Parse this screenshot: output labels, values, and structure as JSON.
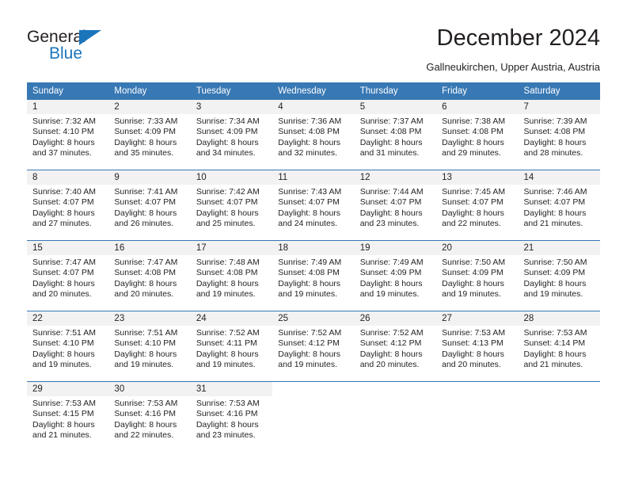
{
  "brand": {
    "name_part1": "General",
    "name_part2": "Blue",
    "color_primary": "#1b75bb",
    "logo_icon": "triangle-icon"
  },
  "header": {
    "title": "December 2024",
    "subtitle": "Gallneukirchen, Upper Austria, Austria"
  },
  "calendar": {
    "header_color": "#3878b4",
    "daynum_background": "#f2f2f2",
    "weekdays": [
      "Sunday",
      "Monday",
      "Tuesday",
      "Wednesday",
      "Thursday",
      "Friday",
      "Saturday"
    ],
    "weeks": [
      [
        {
          "day": "1",
          "sunrise": "Sunrise: 7:32 AM",
          "sunset": "Sunset: 4:10 PM",
          "daylight_line1": "Daylight: 8 hours",
          "daylight_line2": "and 37 minutes."
        },
        {
          "day": "2",
          "sunrise": "Sunrise: 7:33 AM",
          "sunset": "Sunset: 4:09 PM",
          "daylight_line1": "Daylight: 8 hours",
          "daylight_line2": "and 35 minutes."
        },
        {
          "day": "3",
          "sunrise": "Sunrise: 7:34 AM",
          "sunset": "Sunset: 4:09 PM",
          "daylight_line1": "Daylight: 8 hours",
          "daylight_line2": "and 34 minutes."
        },
        {
          "day": "4",
          "sunrise": "Sunrise: 7:36 AM",
          "sunset": "Sunset: 4:08 PM",
          "daylight_line1": "Daylight: 8 hours",
          "daylight_line2": "and 32 minutes."
        },
        {
          "day": "5",
          "sunrise": "Sunrise: 7:37 AM",
          "sunset": "Sunset: 4:08 PM",
          "daylight_line1": "Daylight: 8 hours",
          "daylight_line2": "and 31 minutes."
        },
        {
          "day": "6",
          "sunrise": "Sunrise: 7:38 AM",
          "sunset": "Sunset: 4:08 PM",
          "daylight_line1": "Daylight: 8 hours",
          "daylight_line2": "and 29 minutes."
        },
        {
          "day": "7",
          "sunrise": "Sunrise: 7:39 AM",
          "sunset": "Sunset: 4:08 PM",
          "daylight_line1": "Daylight: 8 hours",
          "daylight_line2": "and 28 minutes."
        }
      ],
      [
        {
          "day": "8",
          "sunrise": "Sunrise: 7:40 AM",
          "sunset": "Sunset: 4:07 PM",
          "daylight_line1": "Daylight: 8 hours",
          "daylight_line2": "and 27 minutes."
        },
        {
          "day": "9",
          "sunrise": "Sunrise: 7:41 AM",
          "sunset": "Sunset: 4:07 PM",
          "daylight_line1": "Daylight: 8 hours",
          "daylight_line2": "and 26 minutes."
        },
        {
          "day": "10",
          "sunrise": "Sunrise: 7:42 AM",
          "sunset": "Sunset: 4:07 PM",
          "daylight_line1": "Daylight: 8 hours",
          "daylight_line2": "and 25 minutes."
        },
        {
          "day": "11",
          "sunrise": "Sunrise: 7:43 AM",
          "sunset": "Sunset: 4:07 PM",
          "daylight_line1": "Daylight: 8 hours",
          "daylight_line2": "and 24 minutes."
        },
        {
          "day": "12",
          "sunrise": "Sunrise: 7:44 AM",
          "sunset": "Sunset: 4:07 PM",
          "daylight_line1": "Daylight: 8 hours",
          "daylight_line2": "and 23 minutes."
        },
        {
          "day": "13",
          "sunrise": "Sunrise: 7:45 AM",
          "sunset": "Sunset: 4:07 PM",
          "daylight_line1": "Daylight: 8 hours",
          "daylight_line2": "and 22 minutes."
        },
        {
          "day": "14",
          "sunrise": "Sunrise: 7:46 AM",
          "sunset": "Sunset: 4:07 PM",
          "daylight_line1": "Daylight: 8 hours",
          "daylight_line2": "and 21 minutes."
        }
      ],
      [
        {
          "day": "15",
          "sunrise": "Sunrise: 7:47 AM",
          "sunset": "Sunset: 4:07 PM",
          "daylight_line1": "Daylight: 8 hours",
          "daylight_line2": "and 20 minutes."
        },
        {
          "day": "16",
          "sunrise": "Sunrise: 7:47 AM",
          "sunset": "Sunset: 4:08 PM",
          "daylight_line1": "Daylight: 8 hours",
          "daylight_line2": "and 20 minutes."
        },
        {
          "day": "17",
          "sunrise": "Sunrise: 7:48 AM",
          "sunset": "Sunset: 4:08 PM",
          "daylight_line1": "Daylight: 8 hours",
          "daylight_line2": "and 19 minutes."
        },
        {
          "day": "18",
          "sunrise": "Sunrise: 7:49 AM",
          "sunset": "Sunset: 4:08 PM",
          "daylight_line1": "Daylight: 8 hours",
          "daylight_line2": "and 19 minutes."
        },
        {
          "day": "19",
          "sunrise": "Sunrise: 7:49 AM",
          "sunset": "Sunset: 4:09 PM",
          "daylight_line1": "Daylight: 8 hours",
          "daylight_line2": "and 19 minutes."
        },
        {
          "day": "20",
          "sunrise": "Sunrise: 7:50 AM",
          "sunset": "Sunset: 4:09 PM",
          "daylight_line1": "Daylight: 8 hours",
          "daylight_line2": "and 19 minutes."
        },
        {
          "day": "21",
          "sunrise": "Sunrise: 7:50 AM",
          "sunset": "Sunset: 4:09 PM",
          "daylight_line1": "Daylight: 8 hours",
          "daylight_line2": "and 19 minutes."
        }
      ],
      [
        {
          "day": "22",
          "sunrise": "Sunrise: 7:51 AM",
          "sunset": "Sunset: 4:10 PM",
          "daylight_line1": "Daylight: 8 hours",
          "daylight_line2": "and 19 minutes."
        },
        {
          "day": "23",
          "sunrise": "Sunrise: 7:51 AM",
          "sunset": "Sunset: 4:10 PM",
          "daylight_line1": "Daylight: 8 hours",
          "daylight_line2": "and 19 minutes."
        },
        {
          "day": "24",
          "sunrise": "Sunrise: 7:52 AM",
          "sunset": "Sunset: 4:11 PM",
          "daylight_line1": "Daylight: 8 hours",
          "daylight_line2": "and 19 minutes."
        },
        {
          "day": "25",
          "sunrise": "Sunrise: 7:52 AM",
          "sunset": "Sunset: 4:12 PM",
          "daylight_line1": "Daylight: 8 hours",
          "daylight_line2": "and 19 minutes."
        },
        {
          "day": "26",
          "sunrise": "Sunrise: 7:52 AM",
          "sunset": "Sunset: 4:12 PM",
          "daylight_line1": "Daylight: 8 hours",
          "daylight_line2": "and 20 minutes."
        },
        {
          "day": "27",
          "sunrise": "Sunrise: 7:53 AM",
          "sunset": "Sunset: 4:13 PM",
          "daylight_line1": "Daylight: 8 hours",
          "daylight_line2": "and 20 minutes."
        },
        {
          "day": "28",
          "sunrise": "Sunrise: 7:53 AM",
          "sunset": "Sunset: 4:14 PM",
          "daylight_line1": "Daylight: 8 hours",
          "daylight_line2": "and 21 minutes."
        }
      ],
      [
        {
          "day": "29",
          "sunrise": "Sunrise: 7:53 AM",
          "sunset": "Sunset: 4:15 PM",
          "daylight_line1": "Daylight: 8 hours",
          "daylight_line2": "and 21 minutes."
        },
        {
          "day": "30",
          "sunrise": "Sunrise: 7:53 AM",
          "sunset": "Sunset: 4:16 PM",
          "daylight_line1": "Daylight: 8 hours",
          "daylight_line2": "and 22 minutes."
        },
        {
          "day": "31",
          "sunrise": "Sunrise: 7:53 AM",
          "sunset": "Sunset: 4:16 PM",
          "daylight_line1": "Daylight: 8 hours",
          "daylight_line2": "and 23 minutes."
        },
        {
          "day": "",
          "sunrise": "",
          "sunset": "",
          "daylight_line1": "",
          "daylight_line2": ""
        },
        {
          "day": "",
          "sunrise": "",
          "sunset": "",
          "daylight_line1": "",
          "daylight_line2": ""
        },
        {
          "day": "",
          "sunrise": "",
          "sunset": "",
          "daylight_line1": "",
          "daylight_line2": ""
        },
        {
          "day": "",
          "sunrise": "",
          "sunset": "",
          "daylight_line1": "",
          "daylight_line2": ""
        }
      ]
    ]
  }
}
